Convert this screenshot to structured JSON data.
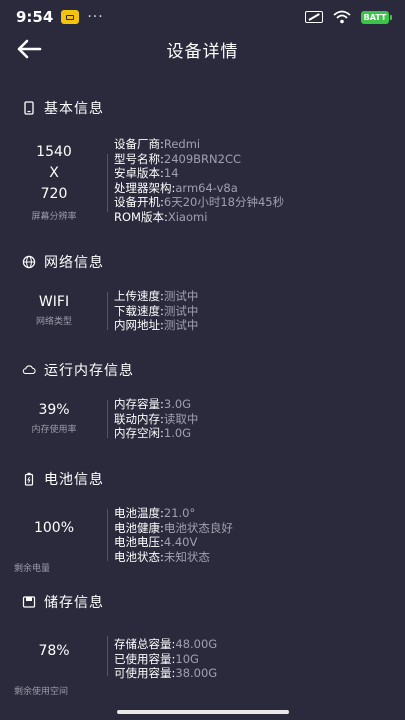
{
  "status": {
    "time": "9:54",
    "dots": "···",
    "battery": "BATT"
  },
  "nav": {
    "title": "设备详情"
  },
  "basic": {
    "title": "基本信息",
    "width": "1540",
    "x": "X",
    "height": "720",
    "label": "屏幕分辨率",
    "rows": [
      {
        "label": "设备厂商:",
        "value": "Redmi"
      },
      {
        "label": "型号名称:",
        "value": "2409BRN2CC"
      },
      {
        "label": "安卓版本:",
        "value": "14"
      },
      {
        "label": "处理器架构:",
        "value": "arm64-v8a"
      },
      {
        "label": "设备开机:",
        "value": "6天20小时18分钟45秒"
      },
      {
        "label": "ROM版本:",
        "value": "Xiaomi"
      }
    ]
  },
  "network": {
    "title": "网络信息",
    "value": "WIFI",
    "label": "网络类型",
    "rows": [
      {
        "label": "上传速度:",
        "value": "测试中"
      },
      {
        "label": "下载速度:",
        "value": "测试中"
      },
      {
        "label": "内网地址:",
        "value": "测试中"
      }
    ]
  },
  "memory": {
    "title": "运行内存信息",
    "value": "39%",
    "label": "内存使用率",
    "rows": [
      {
        "label": "内存容量:",
        "value": "3.0G"
      },
      {
        "label": "联动内存:",
        "value": "读取中"
      },
      {
        "label": "内存空闲:",
        "value": "1.0G"
      }
    ]
  },
  "battery": {
    "title": "电池信息",
    "value": "100%",
    "label": "剩余电量",
    "rows": [
      {
        "label": "电池温度:",
        "value": "21.0°"
      },
      {
        "label": "电池健康:",
        "value": "电池状态良好"
      },
      {
        "label": "电池电压:",
        "value": "4.40V"
      },
      {
        "label": "电池状态:",
        "value": "未知状态"
      }
    ]
  },
  "storage": {
    "title": "储存信息",
    "value": "78%",
    "label": "剩余使用空间",
    "rows": [
      {
        "label": "存储总容量:",
        "value": "48.00G"
      },
      {
        "label": "已使用容量:",
        "value": "10G"
      },
      {
        "label": "可使用容量:",
        "value": "38.00G"
      }
    ]
  }
}
